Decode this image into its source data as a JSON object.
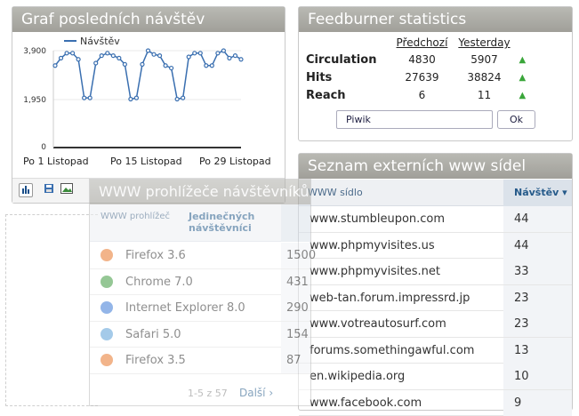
{
  "graph": {
    "title": "Graf posledních návštěv",
    "legend": "Návštěv",
    "y_ticks": [
      "3,900",
      "1,950",
      "0"
    ],
    "x_ticks": [
      "Po 1 Listopad",
      "Po 15 Listopad",
      "Po 29 Listopad"
    ]
  },
  "chart_data": {
    "type": "line",
    "series": [
      {
        "name": "Návštěv",
        "values": [
          3300,
          3600,
          3800,
          3800,
          3550,
          2000,
          2000,
          3400,
          3700,
          3800,
          3700,
          3600,
          3350,
          1950,
          2000,
          3350,
          3900,
          3750,
          3700,
          3300,
          3200,
          1950,
          2000,
          3650,
          3800,
          3800,
          3300,
          3300,
          3800,
          3900,
          3600,
          3700,
          3550
        ]
      }
    ],
    "ylim": [
      0,
      3900
    ],
    "color": "#3a6fb0"
  },
  "toolbar": {
    "icons": [
      "bar-chart-icon",
      "export-icon",
      "image-icon"
    ]
  },
  "feedburner": {
    "title": "Feedburner statistics",
    "col_prev": "Předchozí",
    "col_yesterday": "Yesterday",
    "rows": [
      {
        "label": "Circulation",
        "prev": "4830",
        "yesterday": "5907"
      },
      {
        "label": "Hits",
        "prev": "27639",
        "yesterday": "38824"
      },
      {
        "label": "Reach",
        "prev": "6",
        "yesterday": "11"
      }
    ],
    "input_value": "Piwik",
    "ok_label": "Ok"
  },
  "sites": {
    "title": "Seznam externích www sídel",
    "col_site": "WWW sídlo",
    "col_visits": "Návštěv ▾",
    "rows": [
      {
        "name": "www.stumbleupon.com",
        "value": "44"
      },
      {
        "name": "www.phpmyvisites.us",
        "value": "44"
      },
      {
        "name": "www.phpmyvisites.net",
        "value": "33"
      },
      {
        "name": "web-tan.forum.impressrd.jp",
        "value": "23"
      },
      {
        "name": "www.votreautosurf.com",
        "value": "23"
      },
      {
        "name": "forums.somethingawful.com",
        "value": "13"
      },
      {
        "name": "en.wikipedia.org",
        "value": "10"
      },
      {
        "name": "www.facebook.com",
        "value": "9"
      }
    ]
  },
  "browsers": {
    "title": "WWW prohlížeče návštěvníků",
    "col_browser": "WWW prohlížeč",
    "col_unique": "Jedinečných návštěvníci",
    "rows": [
      {
        "name": "Firefox 3.6",
        "value": "1500",
        "icon": "firefox-icon",
        "color": "#e8782b"
      },
      {
        "name": "Chrome 7.0",
        "value": "431",
        "icon": "chrome-icon",
        "color": "#3f9a3f"
      },
      {
        "name": "Internet Explorer 8.0",
        "value": "290",
        "icon": "ie-icon",
        "color": "#3b7ad6"
      },
      {
        "name": "Safari 5.0",
        "value": "154",
        "icon": "safari-icon",
        "color": "#5aa0d8"
      },
      {
        "name": "Firefox 3.5",
        "value": "87",
        "icon": "firefox-icon",
        "color": "#e8782b"
      }
    ],
    "pagination": "1-5 z 57",
    "next": "Další ›"
  }
}
